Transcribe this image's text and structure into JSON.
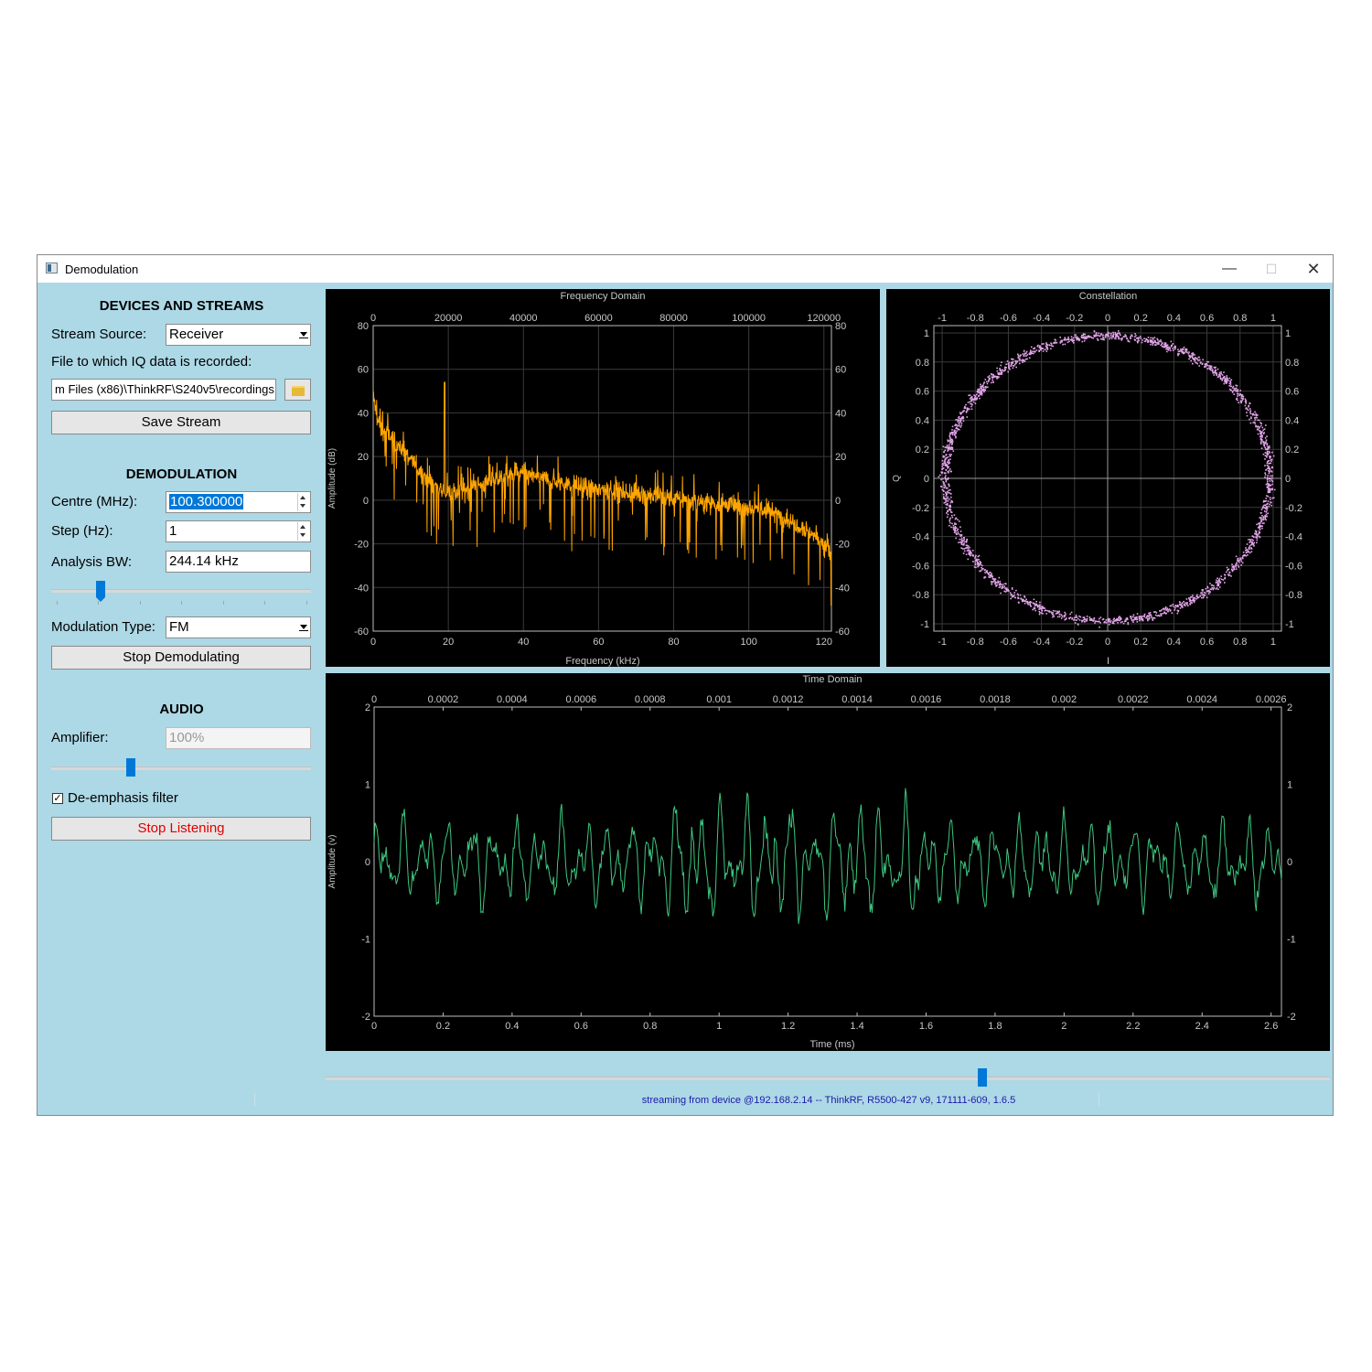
{
  "window": {
    "title": "Demodulation",
    "min_glyph": "—",
    "max_glyph": "☐",
    "close_glyph": "✕"
  },
  "devices": {
    "header": "DEVICES AND STREAMS",
    "stream_source_label": "Stream Source:",
    "stream_source_value": "Receiver",
    "file_label": "File to which IQ data is recorded:",
    "file_value": "m Files (x86)\\ThinkRF\\S240v5\\recordings",
    "save_button": "Save Stream"
  },
  "demodulation": {
    "header": "DEMODULATION",
    "centre_label": "Centre (MHz):",
    "centre_value": "100.300000",
    "step_label": "Step (Hz):",
    "step_value": "1",
    "bw_label": "Analysis BW:",
    "bw_value": "244.14 kHz",
    "bw_slider_fraction": 0.18,
    "mod_type_label": "Modulation Type:",
    "mod_type_value": "FM",
    "stop_button": "Stop Demodulating"
  },
  "audio": {
    "header": "AUDIO",
    "amplifier_label": "Amplifier:",
    "amplifier_value": "100%",
    "amplifier_slider_fraction": 0.3,
    "deemphasis_label": "De-emphasis filter",
    "deemphasis_checked": "✓",
    "stop_button": "Stop Listening"
  },
  "bottom_slider_fraction": 0.655,
  "status_text": "streaming from device @192.168.2.14 -- ThinkRF, R5500-427 v9, 171111-609, 1.6.5",
  "colors": {
    "freq_trace": "#ffa500",
    "constellation": "#e4a6ec",
    "time_trace": "#3dc77f",
    "axis_text": "#c8c8c8"
  },
  "chart_data": [
    {
      "type": "line",
      "title": "Frequency Domain",
      "xlabel": "Frequency (kHz)",
      "ylabel": "Amplitude (dB)",
      "xlim": [
        0,
        122
      ],
      "ylim": [
        -60,
        80
      ],
      "xticks": [
        0,
        20,
        40,
        60,
        80,
        100,
        120
      ],
      "xticks_top": [
        "0",
        "20000",
        "40000",
        "60000",
        "80000",
        "100000",
        "120000"
      ],
      "yticks": [
        -60,
        -40,
        -20,
        0,
        20,
        40,
        60,
        80
      ],
      "series": [
        {
          "values_x": [
            0,
            1,
            2,
            4,
            6,
            8,
            10,
            12,
            15,
            18,
            20,
            22,
            25,
            28,
            32,
            36,
            38,
            40,
            45,
            50,
            55,
            60,
            65,
            70,
            75,
            80,
            85,
            90,
            95,
            100,
            105,
            108,
            112,
            115,
            118,
            120,
            122
          ],
          "values_y": [
            48,
            38,
            33,
            30,
            26,
            23,
            19,
            14,
            9,
            5,
            4,
            3,
            5,
            7,
            9,
            11,
            13,
            12,
            10,
            8,
            6,
            5,
            4,
            3,
            2,
            1,
            0,
            -1,
            -2,
            -3,
            -5,
            -7,
            -10,
            -13,
            -17,
            -20,
            -25
          ]
        }
      ]
    },
    {
      "type": "scatter",
      "title": "Constellation",
      "xlabel": "I",
      "ylabel": "Q",
      "xlim": [
        -1.05,
        1.05
      ],
      "ylim": [
        -1.05,
        1.05
      ],
      "xticks": [
        -1,
        -0.8,
        -0.6,
        -0.4,
        -0.2,
        0,
        0.2,
        0.4,
        0.6,
        0.8,
        1
      ],
      "yticks": [
        -1,
        -0.8,
        -0.6,
        -0.4,
        -0.2,
        0,
        0.2,
        0.4,
        0.6,
        0.8,
        1
      ],
      "series": [
        {
          "shape": "ring",
          "radius": 0.98
        }
      ]
    },
    {
      "type": "line",
      "title": "Time Domain",
      "xlabel": "Time (ms)",
      "ylabel": "Amplitude (v)",
      "xlim": [
        0,
        2.63
      ],
      "ylim": [
        -2,
        2
      ],
      "xticks": [
        0,
        0.2,
        0.4,
        0.6,
        0.8,
        1,
        1.2,
        1.4,
        1.6,
        1.8,
        2,
        2.2,
        2.4,
        2.6
      ],
      "xticks_top": [
        "0",
        "0.0002",
        "0.0004",
        "0.0006",
        "0.0008",
        "0.001",
        "0.0012",
        "0.0014",
        "0.0016",
        "0.0018",
        "0.002",
        "0.0022",
        "0.0024",
        "0.0026"
      ],
      "yticks": [
        -2,
        -1,
        0,
        1,
        2
      ],
      "series": [
        {
          "amplitude_range": [
            -0.9,
            0.95
          ]
        }
      ]
    }
  ]
}
